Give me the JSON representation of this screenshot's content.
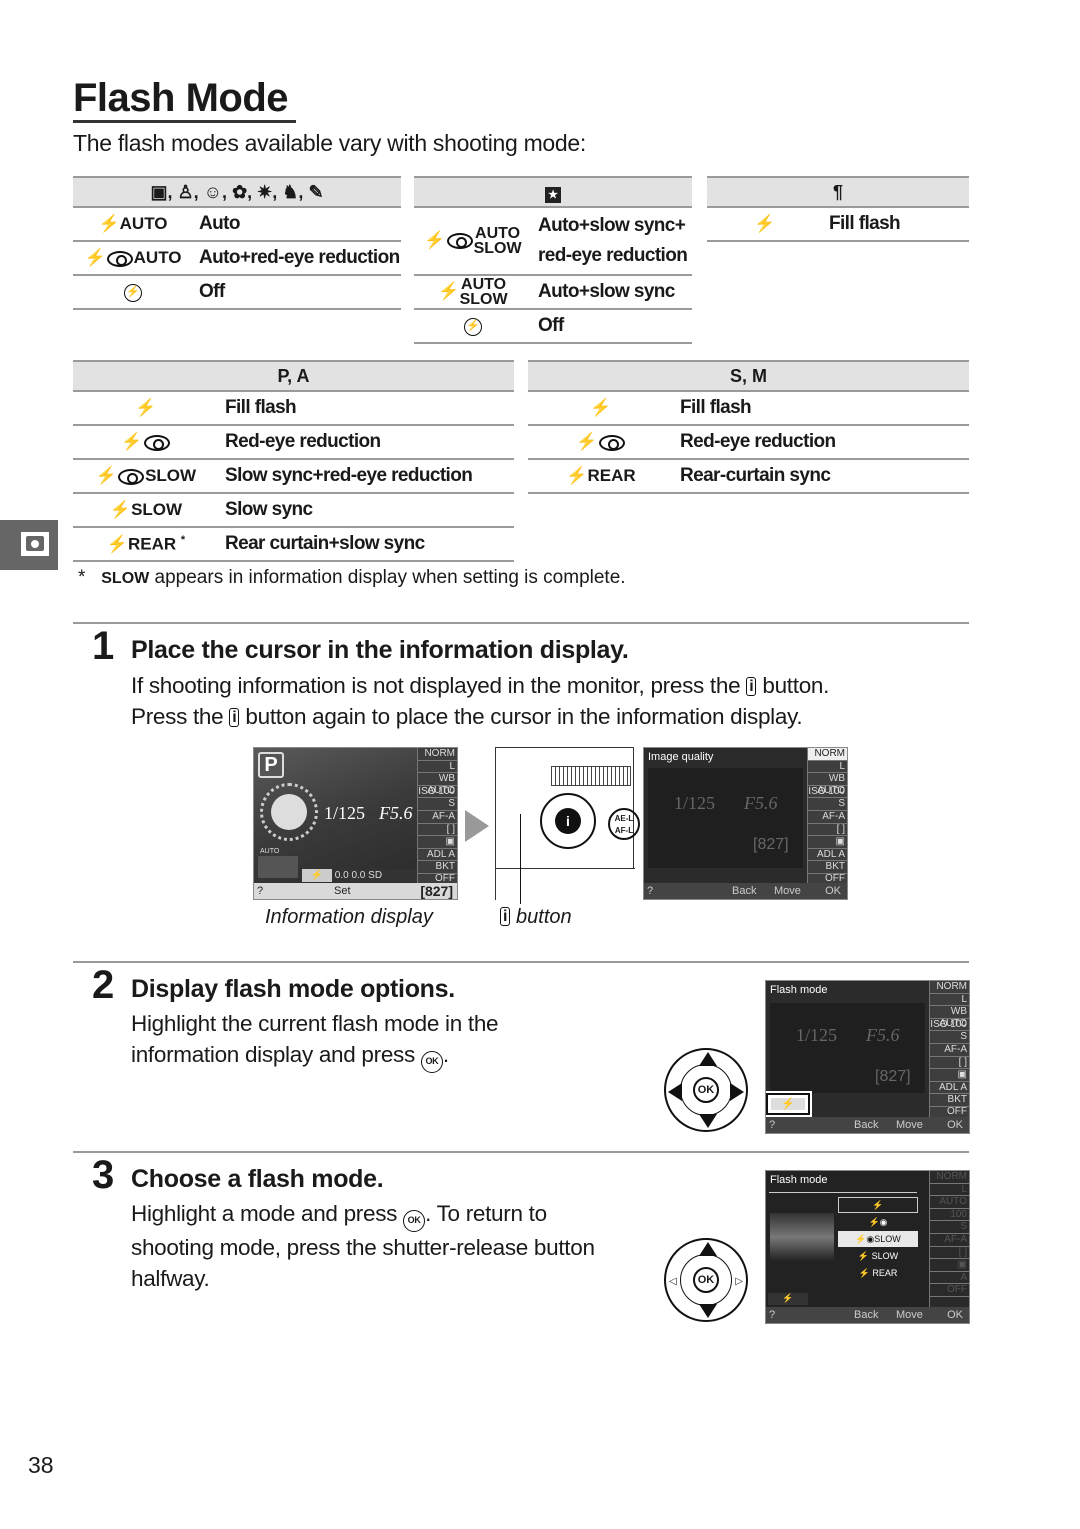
{
  "page": {
    "title": "Flash Mode",
    "intro": "The flash modes available vary with shooting mode:",
    "page_number": "38",
    "side_tab_icon": "camera-icon"
  },
  "tables": {
    "auto_scenes": {
      "header": "AUTO-camera, portrait, child, close-up, night-scene, pet, color-sketch modes",
      "header_icons": [
        "auto-mode-icon",
        "portrait-icon",
        "child-icon",
        "close-up-icon",
        "party-indoor-icon",
        "pet-portrait-icon",
        "special-effects-icon"
      ],
      "rows": [
        {
          "symbol": "⚡AUTO",
          "label": "Auto"
        },
        {
          "symbol": "⚡◉AUTO",
          "label": "Auto+red-eye reduction"
        },
        {
          "symbol": "flash-off",
          "label": "Off"
        }
      ]
    },
    "night_portrait": {
      "header_icon": "night-portrait-icon",
      "rows": [
        {
          "symbol_top": "AUTO",
          "symbol_bottom": "SLOW",
          "label_line1": "Auto+slow sync+",
          "label_line2": "red-eye reduction"
        },
        {
          "symbol_top": "AUTO",
          "symbol_bottom": "SLOW",
          "label_line1": "Auto+slow sync",
          "label_line2": ""
        },
        {
          "symbol": "flash-off",
          "label_line1": "Off",
          "label_line2": ""
        }
      ]
    },
    "food": {
      "header_icon": "food-icon",
      "rows": [
        {
          "symbol": "⚡",
          "label": "Fill flash"
        }
      ]
    },
    "p_a": {
      "header": "P, A",
      "rows": [
        {
          "symbol": "⚡",
          "suffix": "",
          "label": "Fill flash"
        },
        {
          "symbol": "⚡◉",
          "suffix": "",
          "label": "Red-eye reduction"
        },
        {
          "symbol": "⚡◉",
          "suffix": "SLOW",
          "label": "Slow sync+red-eye reduction"
        },
        {
          "symbol": "⚡",
          "suffix": "SLOW",
          "label": "Slow sync"
        },
        {
          "symbol": "⚡",
          "suffix": "REAR",
          "label": "Rear curtain+slow sync",
          "footnote_mark": "*"
        }
      ]
    },
    "s_m": {
      "header": "S, M",
      "rows": [
        {
          "symbol": "⚡",
          "suffix": "",
          "label": "Fill flash"
        },
        {
          "symbol": "⚡◉",
          "suffix": "",
          "label": "Red-eye reduction"
        },
        {
          "symbol": "⚡",
          "suffix": "REAR",
          "label": "Rear-curtain sync"
        }
      ]
    }
  },
  "footnote": {
    "mark": "*",
    "keyword": "SLOW",
    "text": " appears in information display when setting is complete."
  },
  "steps": [
    {
      "number": "1",
      "title": "Place the cursor in the information display.",
      "body_line1_a": "If shooting information is not displayed in the monitor, press the ",
      "body_line1_b": " button.",
      "body_line2_a": "Press the ",
      "body_line2_b": " button again to place the cursor in the information display.",
      "button_glyph": "i",
      "captions": {
        "info_display": "Information display",
        "button": " button"
      }
    },
    {
      "number": "2",
      "title": "Display flash mode options.",
      "body_line1": "Highlight the current flash mode in the",
      "body_line2_a": "information display and press ",
      "body_line2_b": "."
    },
    {
      "number": "3",
      "title": "Choose a flash mode.",
      "body_line1_a": "Highlight a mode and press ",
      "body_line1_b": ".  To return to",
      "body_line2": "shooting mode, press the shutter-release button",
      "body_line3": "halfway."
    }
  ],
  "screens": {
    "info_display": {
      "mode": "P",
      "shutter": "1/125",
      "aperture": "F5.6",
      "auto_label": "AUTO",
      "panel": [
        "NORM",
        "L",
        "WB AUTO",
        "ISO 100",
        "S",
        "AF-A",
        "[ ]",
        "▣",
        "ADL A",
        "BKT OFF"
      ],
      "bottom_items": [
        "⚡",
        "0.0",
        "0.0",
        "SD"
      ],
      "help": "?",
      "set_label": "Set",
      "shots_remaining": "[827]"
    },
    "image_quality": {
      "title": "Image quality",
      "shutter": "1/125",
      "aperture": "F5.6",
      "shots_remaining": "[827]",
      "back": "Back",
      "move": "Move",
      "ok": "OK",
      "panel": [
        "NORM",
        "L",
        "WB AUTO",
        "ISO 100",
        "S",
        "AF-A",
        "[ ]",
        "▣",
        "ADL A",
        "BKT OFF"
      ]
    },
    "flash_mode_step2": {
      "title": "Flash mode",
      "shutter": "1/125",
      "aperture": "F5.6",
      "shots_remaining": "[827]",
      "back": "Back",
      "move": "Move",
      "ok": "OK",
      "panel": [
        "NORM",
        "L",
        "WB AUTO",
        "ISO 100",
        "S",
        "AF-A",
        "[ ]",
        "▣",
        "ADL A",
        "BKT OFF"
      ]
    },
    "flash_mode_step3": {
      "title": "Flash mode",
      "options": [
        "⚡",
        "⚡◉",
        "⚡◉SLOW",
        "⚡ SLOW",
        "⚡ REAR"
      ],
      "highlighted_index": 2,
      "back": "Back",
      "move": "Move",
      "ok": "OK"
    }
  },
  "dpad": {
    "center_label": "OK"
  }
}
